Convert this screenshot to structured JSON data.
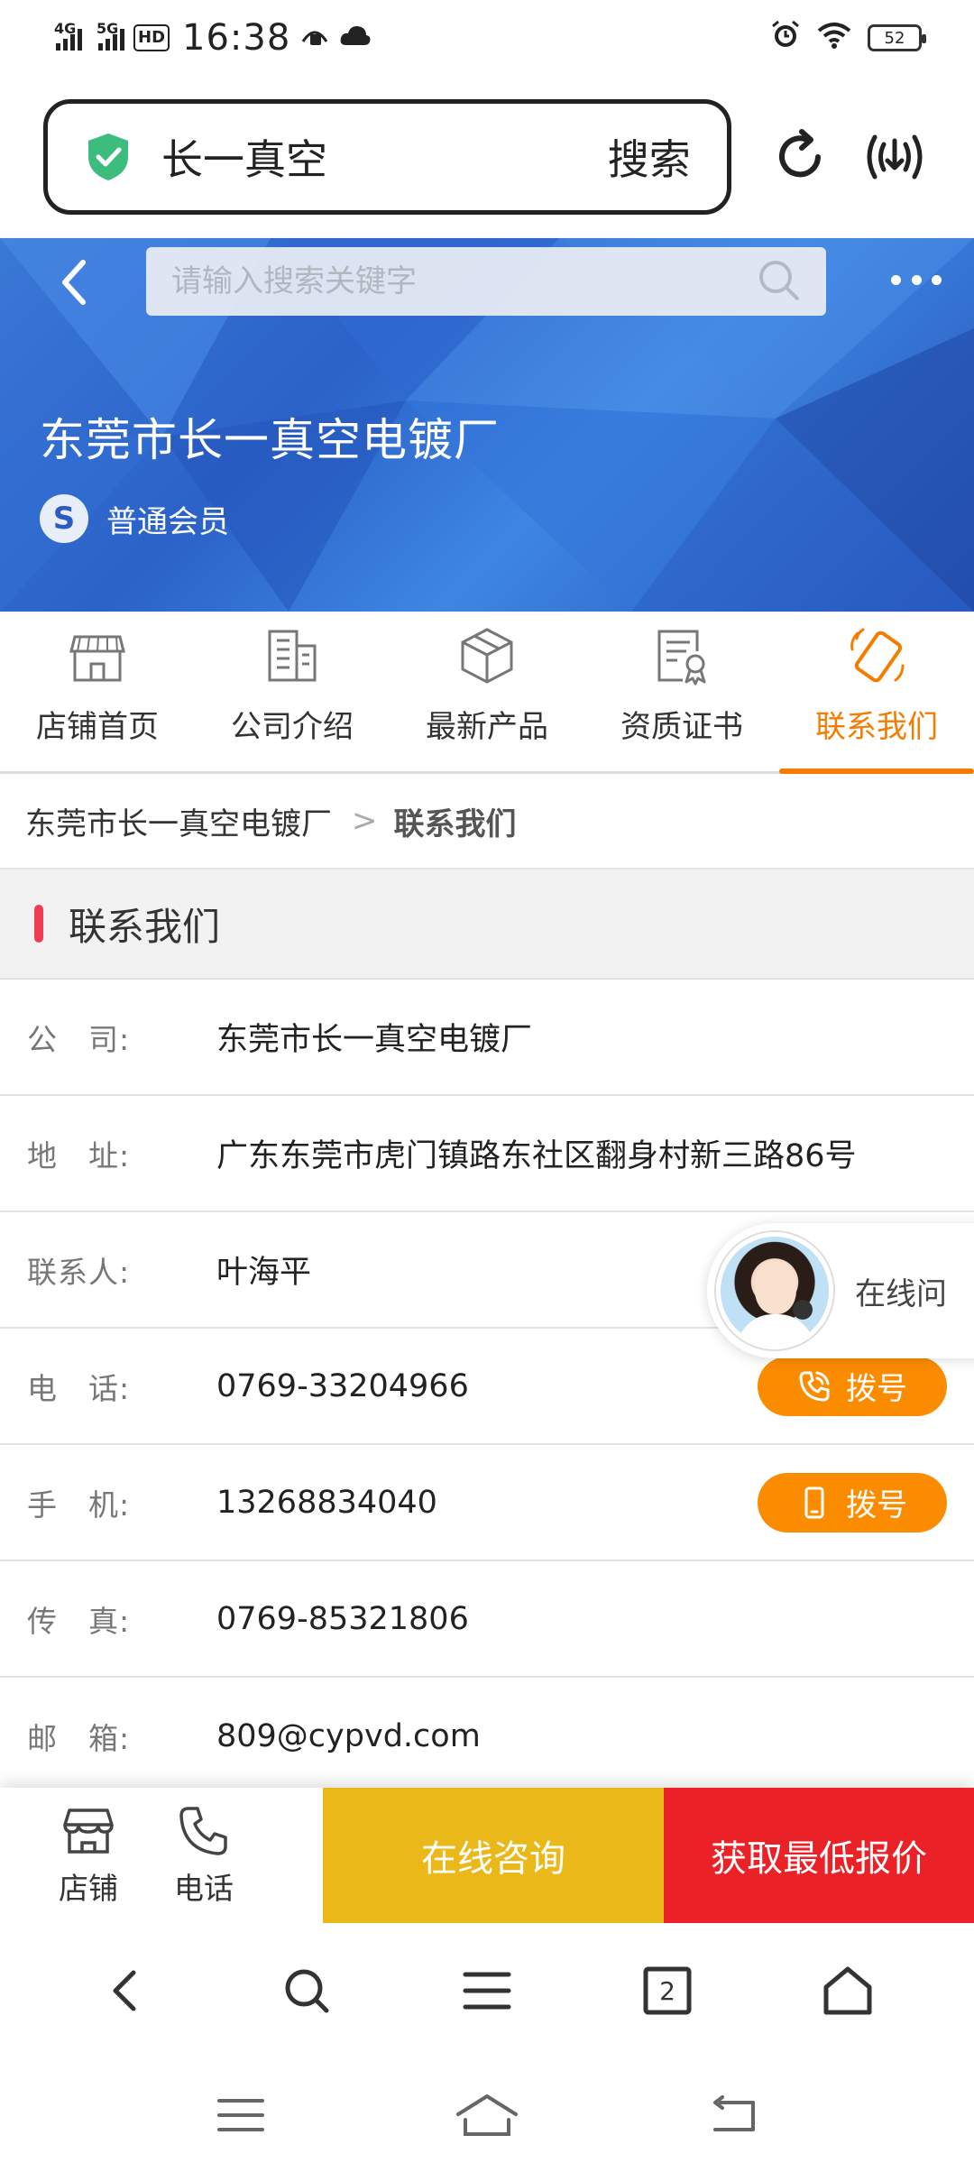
{
  "status_bar": {
    "network_1": "4G",
    "network_2": "5G",
    "hd": "HD",
    "time": "16:38",
    "battery": "52"
  },
  "browser": {
    "address_text": "长一真空",
    "search_label": "搜索"
  },
  "hero": {
    "search_placeholder": "请输入搜索关键字",
    "shop_name": "东莞市长一真空电镀厂",
    "member_badge": "S",
    "member_level": "普通会员"
  },
  "tabs": [
    {
      "label": "店铺首页",
      "icon": "store-icon"
    },
    {
      "label": "公司介绍",
      "icon": "building-icon"
    },
    {
      "label": "最新产品",
      "icon": "box-icon"
    },
    {
      "label": "资质证书",
      "icon": "certificate-icon"
    },
    {
      "label": "联系我们",
      "icon": "phone-contact-icon",
      "active": true
    }
  ],
  "breadcrumb": {
    "link": "东莞市长一真空电镀厂",
    "separator": ">",
    "current": "联系我们"
  },
  "section": {
    "title": "联系我们"
  },
  "contact": {
    "company": {
      "label": "公　司:",
      "value": "东莞市长一真空电镀厂"
    },
    "address": {
      "label": "地　址:",
      "value": "广东东莞市虎门镇路东社区翻身村新三路86号"
    },
    "contact_person": {
      "label": "联系人:",
      "value": "叶海平"
    },
    "phone": {
      "label": "电　话:",
      "value": "0769-33204966",
      "dial_label": "拨号"
    },
    "mobile": {
      "label": "手　机:",
      "value": "13268834040",
      "dial_label": "拨号"
    },
    "fax": {
      "label": "传　真:",
      "value": "0769-85321806"
    },
    "email": {
      "label": "邮　箱:",
      "value": "809@cypvd.com"
    }
  },
  "float_consult": {
    "label": "在线问"
  },
  "action_bar": {
    "store_label": "店铺",
    "phone_label": "电话",
    "consult_label": "在线咨询",
    "quote_label": "获取最低报价"
  },
  "browser_nav": {
    "tab_count": "2"
  },
  "colors": {
    "accent_orange": "#f57c00",
    "dial_orange": "#fb8c00",
    "consult_yellow": "#ebb81a",
    "quote_red": "#ea2127",
    "section_bar_red": "#ef3d52",
    "hero_blue": "#2b62c8",
    "shield_green": "#3dbd7d"
  }
}
